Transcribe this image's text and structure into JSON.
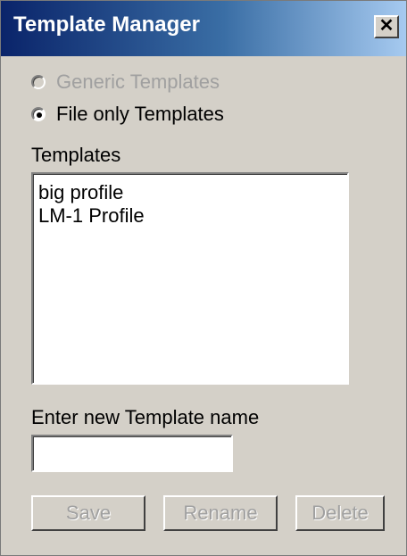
{
  "window": {
    "title": "Template Manager",
    "close_symbol": "✕"
  },
  "radios": [
    {
      "label": "Generic Templates",
      "selected": false,
      "enabled": false
    },
    {
      "label": "File only Templates",
      "selected": true,
      "enabled": true
    }
  ],
  "templates": {
    "label": "Templates",
    "items": [
      "big profile",
      "LM-1 Profile"
    ]
  },
  "new_name": {
    "label": "Enter new Template name",
    "value": ""
  },
  "buttons": {
    "save": "Save",
    "rename": "Rename",
    "delete": "Delete"
  },
  "colors": {
    "titlebar_start": "#0a246a",
    "titlebar_end": "#a6caf0",
    "dialog_bg": "#d4d0c8",
    "disabled_text": "#a0a0a0"
  }
}
